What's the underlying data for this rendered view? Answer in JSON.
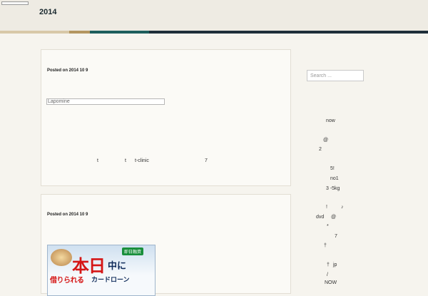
{
  "header": {
    "site_title": "2014"
  },
  "posts": [
    {
      "meta": "Posted on 2014  10  9",
      "link_text": "Lapomine",
      "excerpt": [
        "t",
        "t",
        "t-clinic",
        "7"
      ]
    },
    {
      "meta": "Posted on 2014  10  9",
      "banner": {
        "badge": "即日融資",
        "line1a": "本日",
        "line1b": "中に",
        "line2a": "借りられる",
        "line2b": "カードローン"
      }
    }
  ],
  "sidebar": {
    "search_placeholder": "Search ...",
    "lines": [
      "now",
      "@",
      "2",
      "5!",
      "no1",
      "3  -5kg",
      "!",
      "♪",
      "dvd",
      "@",
      "*",
      "7",
      "†",
      "†",
      "jp",
      "/",
      "NOW"
    ]
  }
}
